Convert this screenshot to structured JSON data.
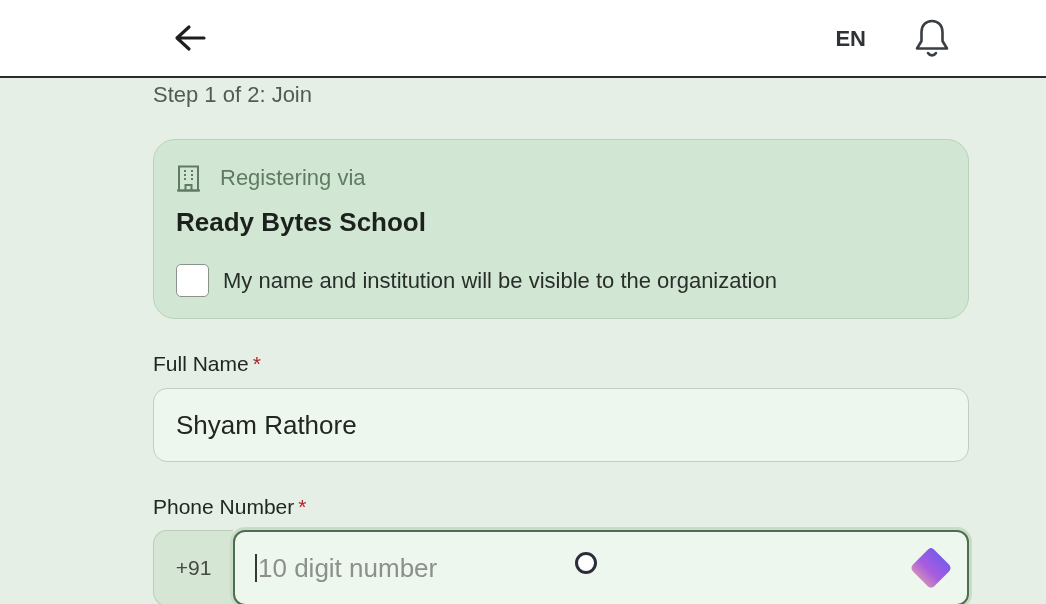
{
  "header": {
    "language": "EN"
  },
  "step": "Step 1 of 2: Join",
  "organization_card": {
    "label": "Registering via",
    "name": "Ready Bytes School",
    "consent": {
      "label": "My name and institution will be visible to the organization",
      "checked": false
    }
  },
  "fields": [
    {
      "kind": "text",
      "label": "Full Name",
      "required_mark": "*",
      "value": "Shyam Rathore",
      "focused": false
    },
    {
      "kind": "phone",
      "label": "Phone Number",
      "required_mark": "*",
      "prefix": "+91",
      "placeholder": "10 digit number",
      "focused": true
    }
  ]
}
